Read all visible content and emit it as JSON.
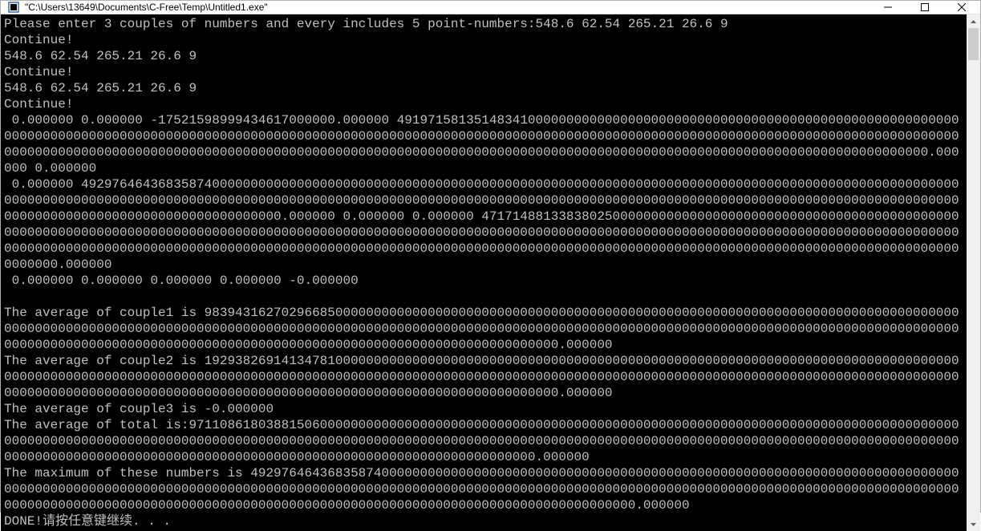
{
  "window": {
    "title": "\"C:\\Users\\13649\\Documents\\C-Free\\Temp\\Untitled1.exe\""
  },
  "console": {
    "lines": [
      "Please enter 3 couples of numbers and every includes 5 point-numbers:548.6 62.54 265.21 26.6 9",
      "Continue!",
      "548.6 62.54 265.21 26.6 9",
      "Continue!",
      "548.6 62.54 265.21 26.6 9",
      "Continue!",
      " 0.000000 0.000000 -17521598999434617000000.000000 49197158135148341000000000000000000000000000000000000000000000000000000000000000000000000000000000000000000000000000000000000000000000000000000000000000000000000000000000000000000000000000000000000000000000000000000000000000000000000000000000000000000000000000000000000000000000000000000000000000000000000000000000000.000000 0.000000",
      " 0.000000 4929764643683587400000000000000000000000000000000000000000000000000000000000000000000000000000000000000000000000000000000000000000000000000000000000000000000000000000000000000000000000000000000000000000000000000000000000000000000000000000000000000000000000000000000000000000.000000 0.000000 0.000000 47171488133838025000000000000000000000000000000000000000000000000000000000000000000000000000000000000000000000000000000000000000000000000000000000000000000000000000000000000000000000000000000000000000000000000000000000000000000000000000000000000000000000000000000000000000000000000000000000000000000000000000000000000.000000",
      " 0.000000 0.000000 0.000000 0.000000 -0.000000",
      "",
      "The average of couple1 is 983943162702966850000000000000000000000000000000000000000000000000000000000000000000000000000000000000000000000000000000000000000000000000000000000000000000000000000000000000000000000000000000000000000000000000000000000000000000000000000000000000000000000000000000000000000000000000000000000000.000000",
      "The average of couple2 is 192938269141347810000000000000000000000000000000000000000000000000000000000000000000000000000000000000000000000000000000000000000000000000000000000000000000000000000000000000000000000000000000000000000000000000000000000000000000000000000000000000000000000000000000000000000000000000000000000000.000000",
      "The average of couple3 is -0.000000",
      "The average of total is:97110861803881506000000000000000000000000000000000000000000000000000000000000000000000000000000000000000000000000000000000000000000000000000000000000000000000000000000000000000000000000000000000000000000000000000000000000000000000000000000000000000000000000000000000000000000000000000000000000.000000",
      "The maximum of these numbers is 4929764643683587400000000000000000000000000000000000000000000000000000000000000000000000000000000000000000000000000000000000000000000000000000000000000000000000000000000000000000000000000000000000000000000000000000000000000000000000000000000000000000000000000000000000000000000000000000000000000000.000000",
      "DONE!请按任意键继续. . ."
    ]
  }
}
